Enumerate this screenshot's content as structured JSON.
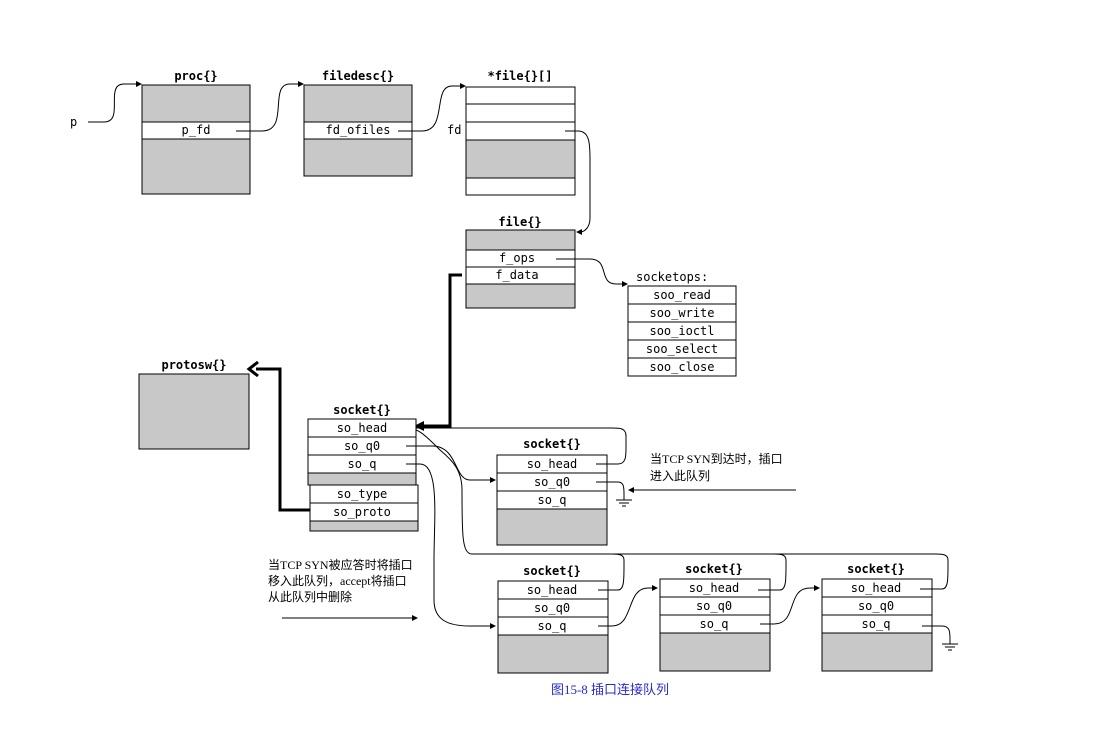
{
  "pointer_p": "p",
  "fd_label": "fd",
  "proc": {
    "title": "proc{}",
    "field": "p_fd"
  },
  "filedesc": {
    "title": "filedesc{}",
    "field": "fd_ofiles"
  },
  "filearray": {
    "title": "*file{}[]"
  },
  "file": {
    "title": "file{}",
    "fields": [
      "f_ops",
      "f_data"
    ]
  },
  "socketops": {
    "title": "socketops:",
    "items": [
      "soo_read",
      "soo_write",
      "soo_ioctl",
      "soo_select",
      "soo_close"
    ]
  },
  "protosw": {
    "title": "protosw{}"
  },
  "main_socket": {
    "title": "socket{}",
    "fields": [
      "so_head",
      "so_q0",
      "so_q",
      "so_type",
      "so_proto"
    ]
  },
  "socket_box": {
    "title": "socket{}",
    "fields": [
      "so_head",
      "so_q0",
      "so_q"
    ]
  },
  "note_q0": {
    "lines": [
      "当TCP SYN到达时，插口",
      "进入此队列"
    ]
  },
  "note_q": {
    "lines": [
      "当TCP SYN被应答时将插口",
      "移入此队列，accept将插口",
      "从此队列中删除"
    ]
  },
  "caption": "图15-8   插口连接队列",
  "colors": {
    "fill": "#c8c8c8",
    "line": "#000000",
    "caption": "#2a2ad0"
  }
}
